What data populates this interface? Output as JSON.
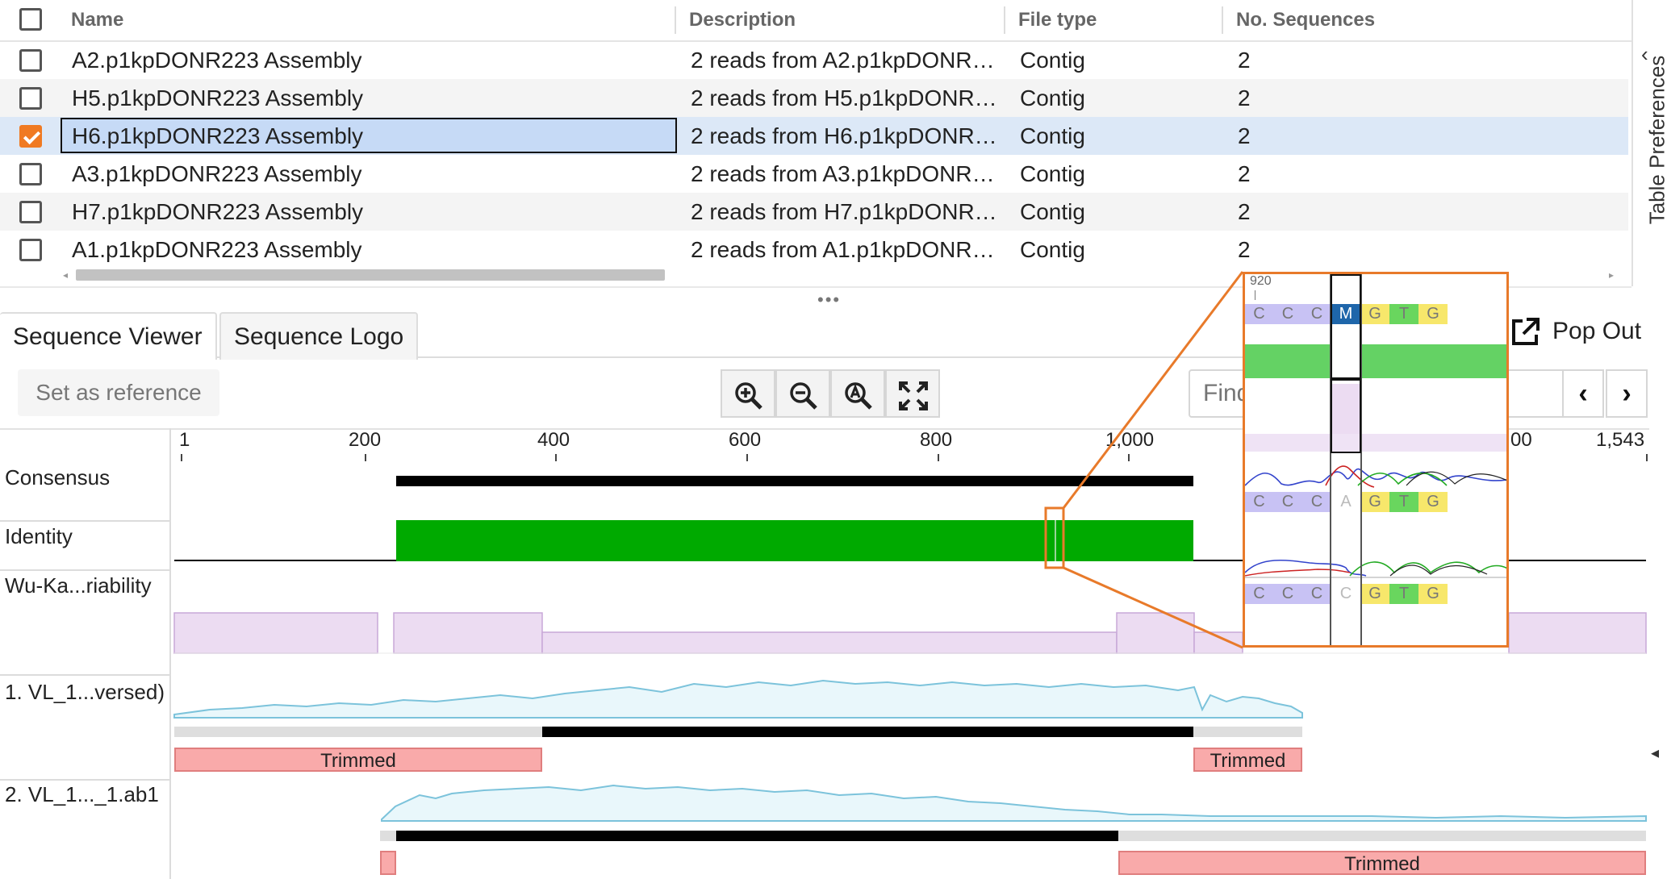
{
  "table": {
    "headers": {
      "name": "Name",
      "description": "Description",
      "file_type": "File type",
      "no_sequences": "No. Sequences"
    },
    "rows": [
      {
        "name": "A2.p1kpDONR223 Assembly",
        "description": "2 reads from A2.p1kpDONR…",
        "file_type": "Contig",
        "no_sequences": "2",
        "checked": false
      },
      {
        "name": "H5.p1kpDONR223 Assembly",
        "description": "2 reads from H5.p1kpDONR…",
        "file_type": "Contig",
        "no_sequences": "2",
        "checked": false
      },
      {
        "name": "H6.p1kpDONR223 Assembly",
        "description": "2 reads from H6.p1kpDONR…",
        "file_type": "Contig",
        "no_sequences": "2",
        "checked": true
      },
      {
        "name": "A3.p1kpDONR223 Assembly",
        "description": "2 reads from A3.p1kpDONR…",
        "file_type": "Contig",
        "no_sequences": "2",
        "checked": false
      },
      {
        "name": "H7.p1kpDONR223 Assembly",
        "description": "2 reads from H7.p1kpDONR…",
        "file_type": "Contig",
        "no_sequences": "2",
        "checked": false
      },
      {
        "name": "A1.p1kpDONR223 Assembly",
        "description": "2 reads from A1.p1kpDONR…",
        "file_type": "Contig",
        "no_sequences": "2",
        "checked": false
      }
    ]
  },
  "side_panel": {
    "label": "Table Preferences"
  },
  "tabs": {
    "viewer": "Sequence Viewer",
    "logo": "Sequence Logo"
  },
  "toolbar": {
    "set_reference": "Set as reference",
    "find_placeholder": "Find",
    "pop_out": "Pop Out"
  },
  "ruler": {
    "ticks": [
      "1",
      "200",
      "400",
      "600",
      "800",
      "1,000",
      "00",
      "1,543"
    ]
  },
  "tracks": {
    "consensus": "Consensus",
    "identity": "Identity",
    "variability": "Wu-Ka...riability",
    "read1": "1. VL_1...versed)",
    "read2": "2. VL_1..._1.ab1"
  },
  "trimmed": {
    "label": "Trimmed"
  },
  "zoom": {
    "position": "920",
    "consensus_bases": [
      "C",
      "C",
      "C",
      "M",
      "G",
      "T",
      "G"
    ],
    "read1_bases": [
      "C",
      "C",
      "C",
      "A",
      "G",
      "T",
      "G"
    ],
    "read2_bases": [
      "C",
      "C",
      "C",
      "C",
      "G",
      "T",
      "G"
    ]
  },
  "colors": {
    "accent": "#f07a22",
    "identity_green": "#00aa00",
    "variability": "#ecdcf2",
    "trimmed": "#f9aaaa",
    "base_C": "#c8c2f4",
    "base_G": "#f7e76b",
    "base_T": "#69d65e",
    "base_M": "#1e66aa"
  }
}
